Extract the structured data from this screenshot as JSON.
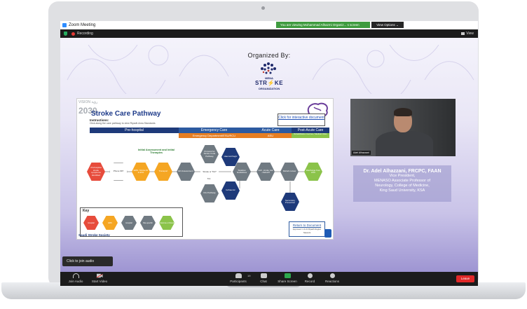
{
  "window": {
    "title": "Zoom Meeting",
    "viewing_banner": "You are viewing Mohammad Alhazmi Organiz... s screen",
    "view_options": "View Options ⌄",
    "recording_label": "Recording",
    "view_label": "View"
  },
  "shared_screen": {
    "organized_by": "Organized By:",
    "logo": {
      "line1": "MENA",
      "line2": "STR⚡KE",
      "line3": "ORGANIZATION"
    },
    "slide": {
      "brand": "VISION رؤية",
      "year": "2030",
      "title": "Stroke Care Pathway",
      "instructions_heading": "Instructions:",
      "instructions_text": "Click along the care pathway to view Riyadh Area Standards",
      "interactive_link": "Click for interactive document",
      "headers": [
        "Pre-hospital",
        "Emergency Care",
        "Acute Care",
        "Post-Acute Care"
      ],
      "subheaders": [
        "Emergency Department/ESU/RCU",
        "ASU",
        "Rehabilitation Centres / Medical Cities"
      ],
      "initial_assessment": "Initial Assessment and Initial Therapies",
      "nodes": {
        "prehospital": "Prehospital stroke symptoms identified",
        "phone": "Phone 997",
        "ems": "EMS: Stroke ID & ETA",
        "transport": "Transport",
        "ed": "ED Assessment",
        "protocol": "Protocol for Stroke Code Pathway",
        "hemorrhage": "Haemorrhagic",
        "stroke_or_tia": "Stroke or TIA?",
        "tia": "TIA",
        "ich": "ICH Pathway",
        "ischemic": "Ischaemic",
        "swallow": "Swallow Guidelines",
        "reperf": "Isch. stroke risk - Rehab?",
        "rehab": "Rehab review",
        "discharge": "Discharge from ASU",
        "secondary": "Secondary Prevention"
      },
      "key": {
        "title": "Key",
        "items": [
          "Hospital",
          "EMS",
          "Hospital",
          "Site-specific",
          "Outcome or Result"
        ]
      },
      "society": "Saudi Stroke Society",
      "return_link": "Return to Document",
      "return_sub": "Approved: 1.3.21  Riyadh Region Network"
    }
  },
  "speaker": {
    "video_name": "Adel Alhazzani",
    "name": "Dr. Adel Alhazzani, FRCPC, FAAN",
    "lines": [
      "Vice President,",
      "MENASO Associate Professor of",
      "Neurology, College of Medicine,",
      "King Saud University, KSA"
    ]
  },
  "tooltip": "Click to join audio",
  "toolbar": {
    "join_audio": "Join Audio",
    "start_video": "Start Video",
    "participants": "Participants",
    "participants_count": "19",
    "chat": "Chat",
    "share_screen": "Share Screen",
    "record": "Record",
    "reactions": "Reactions",
    "leave": "Leave"
  },
  "colors": {
    "share_green": "#2ea94d",
    "leave_red": "#e02828",
    "slide_navy": "#1e3a7a",
    "emergency_orange": "#e67e22",
    "acute_blue": "#2c5aa0"
  }
}
